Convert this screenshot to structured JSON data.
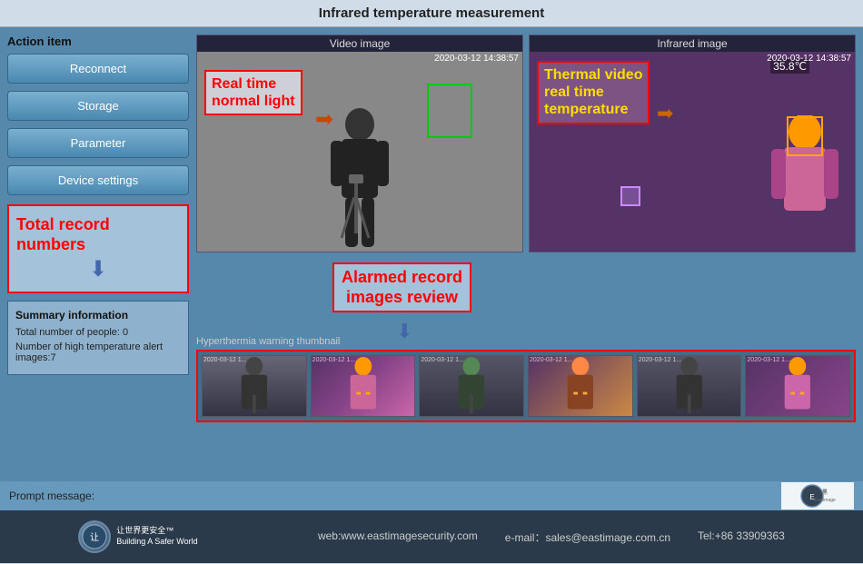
{
  "title": "Infrared temperature measurement",
  "left_panel": {
    "action_item_label": "Action item",
    "buttons": [
      "Reconnect",
      "Storage",
      "Parameter",
      "Device settings"
    ],
    "total_record": {
      "label_line1": "Total record",
      "label_line2": "numbers"
    },
    "summary": {
      "title": "Summary information",
      "people_count": "Total number of people:  0",
      "alert_count": "Number of high temperature alert images:7"
    }
  },
  "video_section": {
    "label": "Video image",
    "timestamp": "2020-03-12 14:38:57",
    "annotation": {
      "line1": "Real time",
      "line2": "normal light"
    }
  },
  "infrared_section": {
    "label": "Infrared image",
    "timestamp": "2020-03-12 14:38:57",
    "annotation": {
      "line1": "Thermal video",
      "line2": "real time",
      "line3": "temperature"
    },
    "temp": "35.8℃"
  },
  "alarmed": {
    "line1": "Alarmed record",
    "line2": "images review"
  },
  "thumbnails": {
    "label": "Hyperthermia warning thumbnail",
    "timestamps": [
      "2020-03-12 1...",
      "2020-03-12 1...",
      "2020-03-12 1...",
      "2020-03-12 1...",
      "2020-03-12 1...",
      "2020-03-12 1..."
    ]
  },
  "bottom": {
    "prompt_label": "Prompt message:",
    "logo_text": "Eastimage"
  },
  "footer": {
    "logo_text_line1": "让世界更安全™",
    "logo_text_line2": "Building A Safer World",
    "website": "web:www.eastimagesecurity.com",
    "email": "e-mail：sales@eastimage.com.cn",
    "tel": "Tel:+86 33909363"
  }
}
